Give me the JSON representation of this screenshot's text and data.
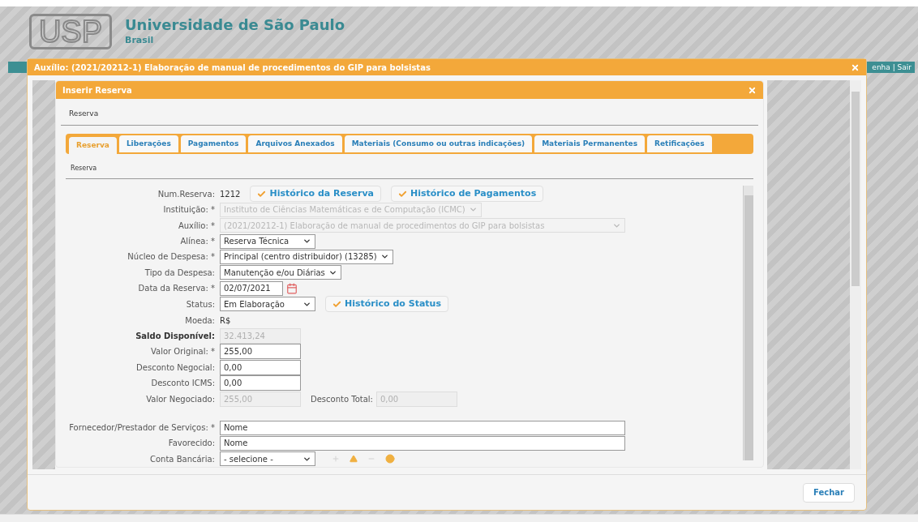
{
  "header": {
    "logo": "USP",
    "title": "Universidade de São Paulo",
    "subtitle": "Brasil",
    "user_links": "enha | Sair"
  },
  "outer_dialog": {
    "title": "Auxílio: (2021/20212-1) Elaboração de manual de procedimentos do GIP para bolsistas",
    "close_button": "Fechar"
  },
  "inner_dialog": {
    "title": "Inserir Reserva",
    "breadcrumb": "Reserva",
    "tabs": [
      {
        "label": "Reserva",
        "selected": true
      },
      {
        "label": "Liberações",
        "selected": false
      },
      {
        "label": "Pagamentos",
        "selected": false
      },
      {
        "label": "Arquivos Anexados",
        "selected": false
      },
      {
        "label": "Materiais (Consumo ou outras indicações)",
        "selected": false
      },
      {
        "label": "Materiais Permanentes",
        "selected": false
      },
      {
        "label": "Retificações",
        "selected": false
      }
    ],
    "section": "Reserva",
    "fields": [
      {
        "label": "Num.Reserva:",
        "kind": "text",
        "value": "1212",
        "buttons": [
          "Histórico da Reserva",
          "Histórico de Pagamentos"
        ]
      },
      {
        "label": "Instituição: *",
        "kind": "select",
        "value": "Instituto de Ciências Matemáticas e de Computação (ICMC)",
        "disabled": true
      },
      {
        "label": "Auxílio: *",
        "kind": "wide_select",
        "value": "(2021/20212-1) Elaboração de manual de procedimentos do GIP para bolsistas",
        "disabled": true
      },
      {
        "label": "Alínea: *",
        "kind": "select",
        "value": "Reserva Técnica",
        "disabled": false
      },
      {
        "label": "Núcleo de Despesa: *",
        "kind": "select",
        "value": "Principal (centro distribuidor) (13285)",
        "disabled": false
      },
      {
        "label": "Tipo da Despesa:",
        "kind": "select",
        "value": "Manutenção e/ou Diárias",
        "disabled": false
      },
      {
        "label": "Data da Reserva: *",
        "kind": "date",
        "value": "02/07/2021"
      },
      {
        "label": "Status:",
        "kind": "select",
        "value": "Em Elaboração",
        "disabled": false,
        "buttons": [
          "Histórico do Status"
        ]
      },
      {
        "label": "Moeda:",
        "kind": "text",
        "value": "R$"
      },
      {
        "label": "Saldo Disponível:",
        "kind": "input",
        "value": "32.413,24",
        "disabled": true,
        "bold": true
      },
      {
        "label": "Valor Original: *",
        "kind": "input",
        "value": "255,00",
        "disabled": false
      },
      {
        "label": "Desconto Negocial:",
        "kind": "input",
        "value": "0,00",
        "disabled": false
      },
      {
        "label": "Desconto ICMS:",
        "kind": "input",
        "value": "0,00",
        "disabled": false
      },
      {
        "label": "Valor Negociado:",
        "kind": "input",
        "value": "255,00",
        "disabled": true,
        "extra_label": "Desconto Total:",
        "extra_value": "0,00"
      }
    ],
    "supplier_fields": [
      {
        "label": "Fornecedor/Prestador de Serviços: *",
        "kind": "wide",
        "value": "Nome"
      },
      {
        "label": "Favorecido:",
        "kind": "wide",
        "value": "Nome"
      },
      {
        "label": "Conta Bancária:",
        "kind": "select",
        "value": "- selecione -",
        "disabled": false,
        "tools": true
      }
    ]
  }
}
